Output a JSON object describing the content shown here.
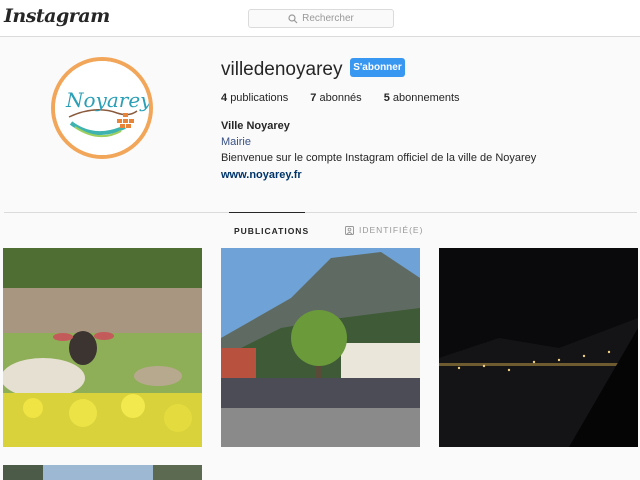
{
  "header": {
    "logo_text": "Instagram",
    "search_placeholder": "Rechercher"
  },
  "profile": {
    "username": "villedenoyarey",
    "follow_label": "S'abonner",
    "stats": {
      "publications_count": "4",
      "publications_label": "publications",
      "followers_count": "7",
      "followers_label": "abonnés",
      "following_count": "5",
      "following_label": "abonnements"
    },
    "full_name": "Ville Noyarey",
    "category": "Mairie",
    "bio": "Bienvenue sur le compte Instagram officiel de la ville de Noyarey",
    "website": "www.noyarey.fr",
    "avatar_logo_text": "Noyarey"
  },
  "tabs": [
    {
      "label": "PUBLICATIONS",
      "icon": "grid-icon",
      "active": true
    },
    {
      "label": "IDENTIFIÉ(E)",
      "icon": "tagged-user-icon",
      "active": false
    }
  ],
  "colors": {
    "follow_button": "#3897f0",
    "avatar_ring": "#f2a65a",
    "link": "#003569"
  }
}
